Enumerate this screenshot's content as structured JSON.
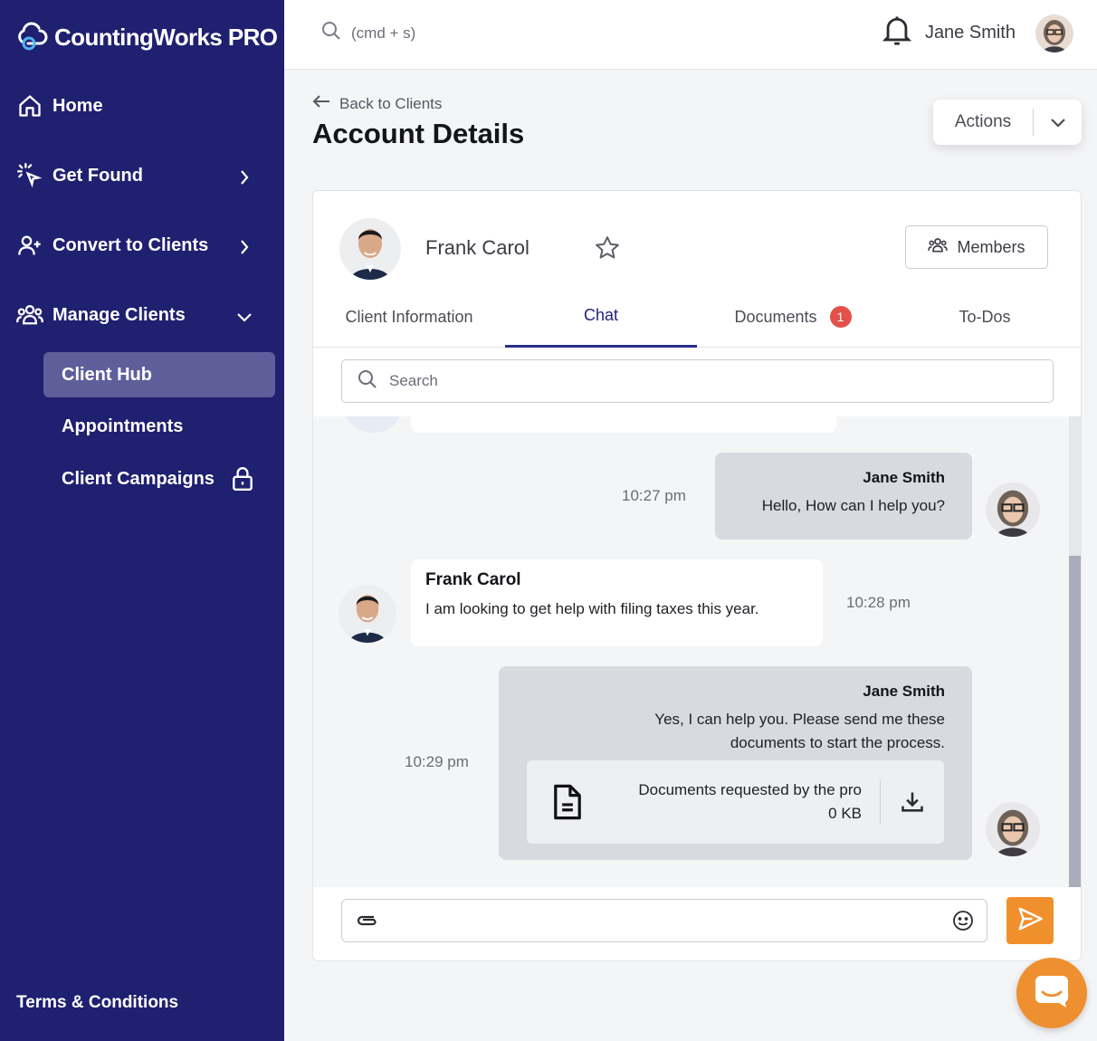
{
  "brand": {
    "name": "CountingWorks PRO"
  },
  "sidebar": {
    "items": [
      {
        "label": "Home",
        "icon": "home-icon"
      },
      {
        "label": "Get Found",
        "icon": "cursor-click-icon"
      },
      {
        "label": "Convert to Clients",
        "icon": "user-plus-icon"
      },
      {
        "label": "Manage Clients",
        "icon": "users-icon"
      }
    ],
    "sub_items": [
      {
        "label": "Client Hub",
        "active": true
      },
      {
        "label": "Appointments"
      },
      {
        "label": "Client Campaigns",
        "icon": "lock-icon"
      }
    ],
    "footer": "Terms & Conditions"
  },
  "topbar": {
    "search_hint": "(cmd + s)",
    "user_name": "Jane Smith"
  },
  "header": {
    "back_label": "Back to Clients",
    "title": "Account Details",
    "actions_label": "Actions"
  },
  "client": {
    "name": "Frank Carol",
    "members_label": "Members",
    "tabs": [
      {
        "label": "Client Information"
      },
      {
        "label": "Chat",
        "active": true
      },
      {
        "label": "Documents",
        "badge": "1"
      },
      {
        "label": "To-Dos"
      }
    ],
    "search_placeholder": "Search"
  },
  "chat": {
    "messages": [
      {
        "sender": "Jane Smith",
        "text": "Hello, How can I help you?",
        "time": "10:27 pm",
        "from_me": true
      },
      {
        "sender": "Frank Carol",
        "text": "I am looking to get help with filing taxes this year.",
        "time": "10:28 pm",
        "from_me": false
      },
      {
        "sender": "Jane Smith",
        "text_line1": "Yes, I can help you. Please send me these",
        "text_line2": "documents to start the process.",
        "time": "10:29 pm",
        "from_me": true,
        "attachment": {
          "title": "Documents requested by the pro",
          "size": "0 KB"
        }
      }
    ]
  },
  "colors": {
    "sidebar": "#1f2070",
    "accent": "#f0902c",
    "active_tab": "#22247a",
    "badge": "#e3514a"
  }
}
